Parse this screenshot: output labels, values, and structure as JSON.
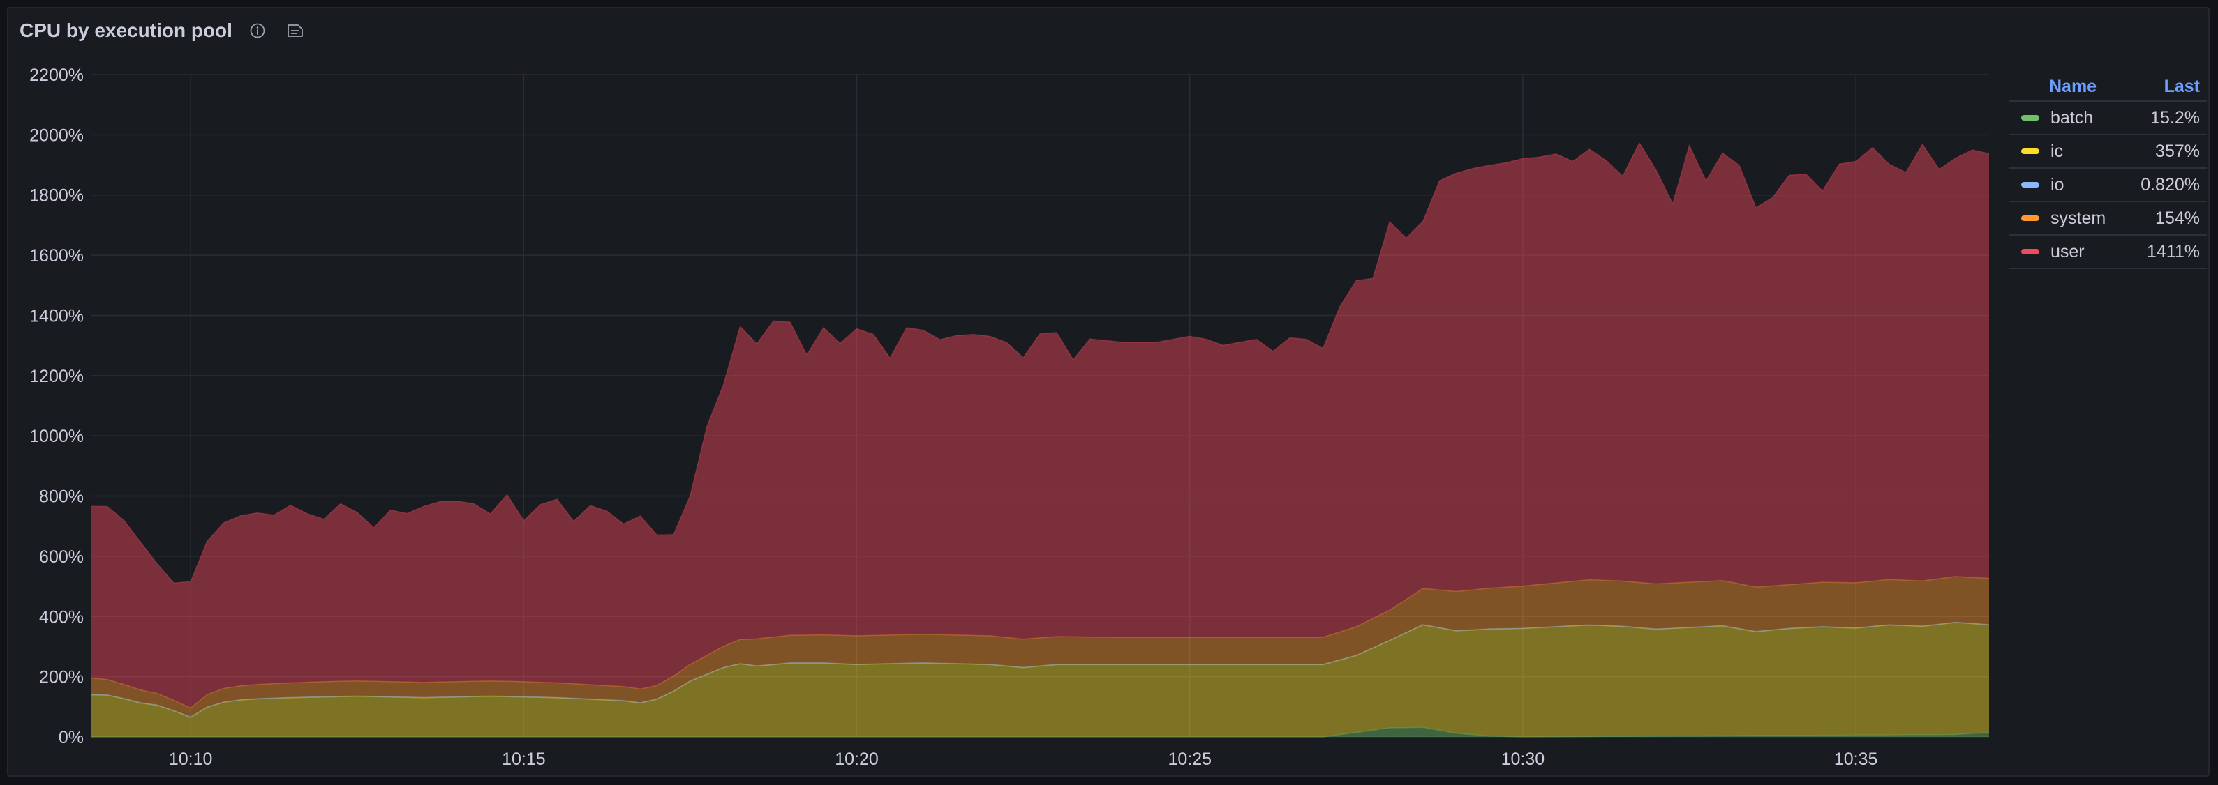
{
  "panel": {
    "title": "CPU by execution pool",
    "info_icon": "info-circle-icon",
    "notes_icon": "panel-notes-icon"
  },
  "legend": {
    "header_name": "Name",
    "header_last": "Last",
    "items": [
      {
        "name": "batch",
        "last": "15.2%",
        "color": "#73bf69"
      },
      {
        "name": "ic",
        "last": "357%",
        "color": "#fade2a"
      },
      {
        "name": "io",
        "last": "0.820%",
        "color": "#8ab8ff"
      },
      {
        "name": "system",
        "last": "154%",
        "color": "#ff9830"
      },
      {
        "name": "user",
        "last": "1411%",
        "color": "#f2495c"
      }
    ]
  },
  "chart_data": {
    "type": "area",
    "stacked": true,
    "title": "CPU by execution pool",
    "xlabel": "",
    "ylabel": "",
    "x_start": "10:08:30",
    "x_end": "10:37:00",
    "x_ticks": [
      "10:10",
      "10:15",
      "10:20",
      "10:25",
      "10:30",
      "10:35"
    ],
    "ylim": [
      0,
      2200
    ],
    "y_ticks": [
      0,
      200,
      400,
      600,
      800,
      1000,
      1200,
      1400,
      1600,
      1800,
      2000,
      2200
    ],
    "y_tick_labels": [
      "0%",
      "200%",
      "400%",
      "600%",
      "800%",
      "1000%",
      "1200%",
      "1400%",
      "1600%",
      "1800%",
      "2000%",
      "2200%"
    ],
    "grid": true,
    "legend_position": "right",
    "series": [
      {
        "name": "batch",
        "color": "#73bf69",
        "points": [
          [
            "10:08:30",
            0
          ],
          [
            "10:20:00",
            0
          ],
          [
            "10:27:00",
            0
          ],
          [
            "10:27:30",
            15
          ],
          [
            "10:28:00",
            30
          ],
          [
            "10:28:30",
            32
          ],
          [
            "10:29:00",
            12
          ],
          [
            "10:29:30",
            3
          ],
          [
            "10:30:00",
            0
          ],
          [
            "10:36:30",
            8
          ],
          [
            "10:37:00",
            15
          ]
        ]
      },
      {
        "name": "ic",
        "color": "#fade2a",
        "points": [
          [
            "10:08:30",
            140
          ],
          [
            "10:08:50",
            138
          ],
          [
            "10:09:10",
            115
          ],
          [
            "10:09:30",
            105
          ],
          [
            "10:09:50",
            80
          ],
          [
            "10:10:00",
            65
          ],
          [
            "10:10:20",
            110
          ],
          [
            "10:10:50",
            125
          ],
          [
            "10:11:30",
            130
          ],
          [
            "10:12:30",
            135
          ],
          [
            "10:13:30",
            130
          ],
          [
            "10:14:30",
            135
          ],
          [
            "10:15:30",
            130
          ],
          [
            "10:16:30",
            120
          ],
          [
            "10:16:50",
            110
          ],
          [
            "10:17:10",
            140
          ],
          [
            "10:17:30",
            185
          ],
          [
            "10:17:50",
            215
          ],
          [
            "10:18:10",
            245
          ],
          [
            "10:18:30",
            235
          ],
          [
            "10:19:00",
            245
          ],
          [
            "10:19:30",
            245
          ],
          [
            "10:20:00",
            240
          ],
          [
            "10:21:00",
            245
          ],
          [
            "10:22:00",
            240
          ],
          [
            "10:22:30",
            230
          ],
          [
            "10:23:00",
            240
          ],
          [
            "10:24:00",
            240
          ],
          [
            "10:25:00",
            240
          ],
          [
            "10:26:00",
            240
          ],
          [
            "10:27:00",
            240
          ],
          [
            "10:27:30",
            255
          ],
          [
            "10:28:00",
            290
          ],
          [
            "10:28:30",
            340
          ],
          [
            "10:29:00",
            340
          ],
          [
            "10:29:30",
            355
          ],
          [
            "10:30:00",
            360
          ],
          [
            "10:30:30",
            365
          ],
          [
            "10:31:00",
            370
          ],
          [
            "10:31:30",
            365
          ],
          [
            "10:32:00",
            355
          ],
          [
            "10:32:30",
            360
          ],
          [
            "10:33:00",
            365
          ],
          [
            "10:33:30",
            345
          ],
          [
            "10:34:00",
            355
          ],
          [
            "10:34:30",
            360
          ],
          [
            "10:35:00",
            355
          ],
          [
            "10:35:30",
            365
          ],
          [
            "10:36:00",
            360
          ],
          [
            "10:36:30",
            372
          ],
          [
            "10:37:00",
            357
          ]
        ]
      },
      {
        "name": "io",
        "color": "#8ab8ff",
        "points": [
          [
            "10:08:30",
            1
          ],
          [
            "10:37:00",
            0.82
          ]
        ]
      },
      {
        "name": "system",
        "color": "#ff9830",
        "points": [
          [
            "10:08:30",
            55
          ],
          [
            "10:10:00",
            30
          ],
          [
            "10:10:20",
            45
          ],
          [
            "10:12:00",
            50
          ],
          [
            "10:15:00",
            50
          ],
          [
            "10:17:00",
            45
          ],
          [
            "10:17:30",
            55
          ],
          [
            "10:18:00",
            70
          ],
          [
            "10:18:30",
            90
          ],
          [
            "10:20:00",
            95
          ],
          [
            "10:22:00",
            95
          ],
          [
            "10:24:00",
            90
          ],
          [
            "10:26:00",
            90
          ],
          [
            "10:27:00",
            90
          ],
          [
            "10:27:30",
            95
          ],
          [
            "10:28:00",
            100
          ],
          [
            "10:28:30",
            120
          ],
          [
            "10:29:00",
            130
          ],
          [
            "10:30:00",
            140
          ],
          [
            "10:31:00",
            150
          ],
          [
            "10:32:00",
            150
          ],
          [
            "10:33:00",
            150
          ],
          [
            "10:34:00",
            145
          ],
          [
            "10:35:00",
            150
          ],
          [
            "10:36:00",
            150
          ],
          [
            "10:37:00",
            154
          ]
        ]
      },
      {
        "name": "user",
        "color": "#f2495c",
        "points": [
          [
            "10:08:30",
            570
          ],
          [
            "10:08:45",
            575
          ],
          [
            "10:09:00",
            545
          ],
          [
            "10:09:15",
            490
          ],
          [
            "10:09:30",
            430
          ],
          [
            "10:09:45",
            390
          ],
          [
            "10:10:00",
            420
          ],
          [
            "10:10:15",
            510
          ],
          [
            "10:10:30",
            550
          ],
          [
            "10:10:45",
            565
          ],
          [
            "10:11:00",
            570
          ],
          [
            "10:11:15",
            560
          ],
          [
            "10:11:30",
            590
          ],
          [
            "10:11:45",
            560
          ],
          [
            "10:12:00",
            540
          ],
          [
            "10:12:15",
            590
          ],
          [
            "10:12:30",
            560
          ],
          [
            "10:12:45",
            510
          ],
          [
            "10:13:00",
            570
          ],
          [
            "10:13:15",
            560
          ],
          [
            "10:13:30",
            585
          ],
          [
            "10:13:45",
            600
          ],
          [
            "10:14:00",
            600
          ],
          [
            "10:14:15",
            590
          ],
          [
            "10:14:30",
            555
          ],
          [
            "10:14:45",
            620
          ],
          [
            "10:15:00",
            535
          ],
          [
            "10:15:15",
            590
          ],
          [
            "10:15:30",
            610
          ],
          [
            "10:15:45",
            540
          ],
          [
            "10:16:00",
            595
          ],
          [
            "10:16:15",
            580
          ],
          [
            "10:16:30",
            540
          ],
          [
            "10:16:45",
            575
          ],
          [
            "10:17:00",
            500
          ],
          [
            "10:17:15",
            470
          ],
          [
            "10:17:30",
            560
          ],
          [
            "10:17:45",
            760
          ],
          [
            "10:18:00",
            870
          ],
          [
            "10:18:15",
            1040
          ],
          [
            "10:18:30",
            980
          ],
          [
            "10:18:45",
            1050
          ],
          [
            "10:19:00",
            1040
          ],
          [
            "10:19:15",
            930
          ],
          [
            "10:19:30",
            1020
          ],
          [
            "10:19:45",
            970
          ],
          [
            "10:20:00",
            1020
          ],
          [
            "10:20:15",
            1000
          ],
          [
            "10:20:30",
            920
          ],
          [
            "10:20:45",
            1020
          ],
          [
            "10:21:00",
            1010
          ],
          [
            "10:21:15",
            980
          ],
          [
            "10:21:30",
            995
          ],
          [
            "10:21:45",
            1000
          ],
          [
            "10:22:00",
            995
          ],
          [
            "10:22:15",
            980
          ],
          [
            "10:22:30",
            935
          ],
          [
            "10:22:45",
            1010
          ],
          [
            "10:23:00",
            1010
          ],
          [
            "10:23:15",
            920
          ],
          [
            "10:23:30",
            990
          ],
          [
            "10:24:00",
            980
          ],
          [
            "10:24:30",
            980
          ],
          [
            "10:25:00",
            1000
          ],
          [
            "10:25:15",
            990
          ],
          [
            "10:25:30",
            970
          ],
          [
            "10:25:45",
            980
          ],
          [
            "10:26:00",
            990
          ],
          [
            "10:26:15",
            950
          ],
          [
            "10:26:30",
            995
          ],
          [
            "10:26:45",
            990
          ],
          [
            "10:27:00",
            960
          ],
          [
            "10:27:15",
            1080
          ],
          [
            "10:27:30",
            1150
          ],
          [
            "10:27:45",
            1130
          ],
          [
            "10:28:00",
            1290
          ],
          [
            "10:28:15",
            1200
          ],
          [
            "10:28:30",
            1220
          ],
          [
            "10:28:45",
            1360
          ],
          [
            "10:29:00",
            1390
          ],
          [
            "10:29:15",
            1400
          ],
          [
            "10:29:30",
            1405
          ],
          [
            "10:29:45",
            1410
          ],
          [
            "10:30:00",
            1420
          ],
          [
            "10:30:15",
            1420
          ],
          [
            "10:30:30",
            1425
          ],
          [
            "10:30:45",
            1395
          ],
          [
            "10:31:00",
            1430
          ],
          [
            "10:31:15",
            1395
          ],
          [
            "10:31:30",
            1345
          ],
          [
            "10:31:45",
            1460
          ],
          [
            "10:32:00",
            1375
          ],
          [
            "10:32:15",
            1260
          ],
          [
            "10:32:30",
            1450
          ],
          [
            "10:32:45",
            1330
          ],
          [
            "10:33:00",
            1420
          ],
          [
            "10:33:15",
            1390
          ],
          [
            "10:33:30",
            1260
          ],
          [
            "10:33:45",
            1290
          ],
          [
            "10:34:00",
            1360
          ],
          [
            "10:34:15",
            1360
          ],
          [
            "10:34:30",
            1300
          ],
          [
            "10:34:45",
            1390
          ],
          [
            "10:35:00",
            1400
          ],
          [
            "10:35:15",
            1440
          ],
          [
            "10:35:30",
            1380
          ],
          [
            "10:35:45",
            1355
          ],
          [
            "10:36:00",
            1450
          ],
          [
            "10:36:15",
            1360
          ],
          [
            "10:36:30",
            1390
          ],
          [
            "10:36:45",
            1420
          ],
          [
            "10:37:00",
            1411
          ]
        ]
      }
    ]
  }
}
